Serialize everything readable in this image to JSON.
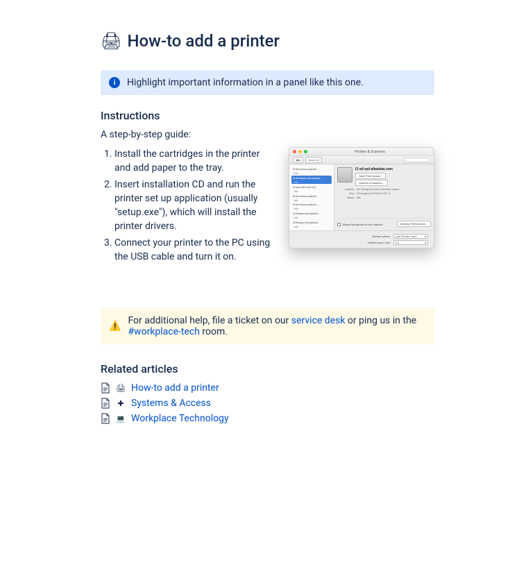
{
  "page": {
    "title_emoji": "🖨",
    "title": "How-to add a printer"
  },
  "info_panel": {
    "text": "Highlight important information in a panel like this one."
  },
  "instructions": {
    "heading": "Instructions",
    "intro": "A step-by-step guide:",
    "steps": [
      "Install the cartridges in the printer and add paper to the tray.",
      "Insert installation CD and run the printer set up application (usually \"setup.exe\"), which will install the printer drivers.",
      "Connect your printer to the PC using the USB cable and turn it on."
    ]
  },
  "mock_window": {
    "title": "Printers & Scanners",
    "back_label": "◀ ▶",
    "show_all": "Show All",
    "search_placeholder": "Q",
    "sidebar_items": [
      {
        "name": "l2-a3-colour.syd.atl...",
        "sub": "• Idle"
      },
      {
        "name": "l2-a4-black.syd.atlassi...",
        "sub": "• Idle"
      },
      {
        "name": "l2-syd-mfm-a4-col...",
        "sub": "• Idle"
      },
      {
        "name": "l3-a4-colour.syd.atl...",
        "sub": "• Idle"
      },
      {
        "name": "l4-a4-colour.syd.atl...",
        "sub": "• Idle"
      },
      {
        "name": "l4-finance-a3.syd.atl...",
        "sub": "• Idle"
      },
      {
        "name": "l4-finance-a4.syd.atl...",
        "sub": "• Idle"
      }
    ],
    "selected_index": 1,
    "printer_name": "l2-a4.syd.atlassian.com",
    "open_queue": "Open Print Queue...",
    "options": "Options & Supplies...",
    "location_k": "Location:",
    "location_v": "361 George St, Level 2, 2nd floor secure",
    "kind_k": "Kind:",
    "kind_v": "HP DesignJet M7225 dn PCL 5",
    "status_k": "Status:",
    "status_v": "Idle",
    "share_label": "Share this printer on the network",
    "share_prefs": "Sharing Preferences...",
    "default_printer_k": "Default printer:",
    "default_printer_v": "Last Printer Used",
    "paper_k": "Default paper size:",
    "paper_v": "A4"
  },
  "warn_panel": {
    "prefix": "For additional help, file a ticket on our ",
    "link1": "service desk",
    "mid": " or ping us in the ",
    "link2": "#workplace-tech",
    "suffix": " room."
  },
  "related": {
    "heading": "Related articles",
    "items": [
      {
        "emoji": "🖨",
        "label": "How-to add a printer"
      },
      {
        "emoji": "✚",
        "label": "Systems & Access"
      },
      {
        "emoji": "💻",
        "label": "Workplace Technology"
      }
    ]
  }
}
